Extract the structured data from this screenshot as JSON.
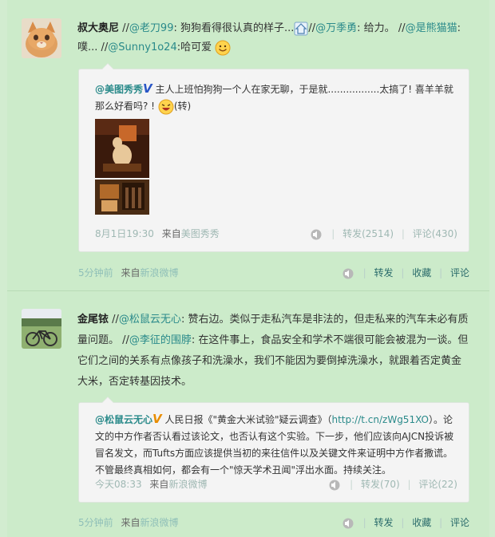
{
  "post1": {
    "author": "叔大奥尼",
    "text_parts": [
      {
        "t": "//",
        "k": "plain"
      },
      {
        "t": "@老刀99",
        "k": "link"
      },
      {
        "t": ": 狗狗看得很认真的样子...",
        "k": "plain"
      },
      {
        "t": "//",
        "k": "plain"
      },
      {
        "t": "@万季勇",
        "k": "link"
      },
      {
        "t": ": 给力。 //",
        "k": "plain"
      },
      {
        "t": "@是熊猫猫",
        "k": "link"
      },
      {
        "t": ": 噗... //",
        "k": "plain"
      },
      {
        "t": "@Sunny1o24",
        "k": "link"
      },
      {
        "t": ":哈可爱",
        "k": "plain"
      }
    ],
    "repost": {
      "author": "@美图秀秀",
      "verified": "V",
      "text": "主人上班怕狗狗一个人在家无聊，于是就.................太搞了! 喜羊羊就那么好看吗? !",
      "suffix": "(转)",
      "time": "8月1日19:30",
      "from_label": "来自",
      "from": "美图秀秀",
      "repost_label": "转发(2514)",
      "comment_label": "评论(430)"
    },
    "footer": {
      "time": "5分钟前",
      "from_label": "来自",
      "from": "新浪微博",
      "repost": "转发",
      "favorite": "收藏",
      "comment": "评论"
    }
  },
  "post2": {
    "author": "金尾铱",
    "text_parts": [
      {
        "t": "//",
        "k": "plain"
      },
      {
        "t": "@松鼠云无心",
        "k": "link"
      },
      {
        "t": ": 赞右边。类似于走私汽车是非法的，但走私来的汽车未必有质量问题。 //",
        "k": "plain"
      },
      {
        "t": "@李征的围脖",
        "k": "link"
      },
      {
        "t": ": 在这件事上，食品安全和学术不端很可能会被混为一谈。但它们之间的关系有点像孩子和洗澡水，我们不能因为要倒掉洗澡水，就跟着否定黄金大米，否定转基因技术。",
        "k": "plain"
      }
    ],
    "repost": {
      "author": "@松鼠云无心",
      "verified": "V",
      "text_a": "人民日报《\"黄金大米试验\"疑云调查》（",
      "url": "http://t.cn/zWg51XO",
      "text_b": "）。论文的中方作者否认看过该论文，也否认有这个实验。下一步，他们应该向AJCN投诉被冒名发文，而Tufts方面应该提供当初的来往信件以及关键文件来证明中方作者撒谎。不管最终真相如何，都会有一个\"惊天学术丑闻\"浮出水面。持续关注。",
      "time": "今天08:33",
      "from_label": "来自",
      "from": "新浪微博",
      "repost_label": "转发(70)",
      "comment_label": "评论(22)"
    },
    "footer": {
      "time": "5分钟前",
      "from_label": "来自",
      "from": "新浪微博",
      "repost": "转发",
      "favorite": "收藏",
      "comment": "评论"
    }
  }
}
